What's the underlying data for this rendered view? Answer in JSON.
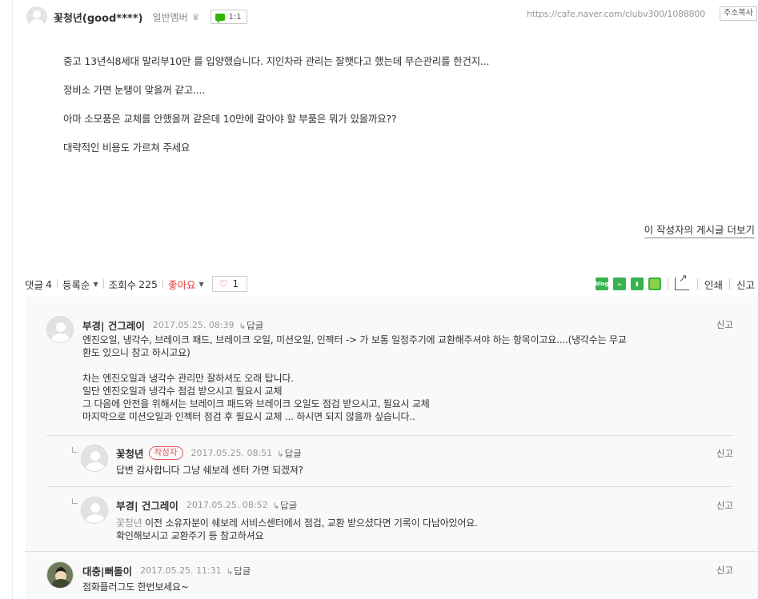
{
  "post": {
    "author_name": "꽃청년(good****)",
    "author_grade": "일반멤버",
    "chat_label": "1:1",
    "url": "https://cafe.naver.com/clubv300/1088800",
    "copy_label": "주소복사",
    "paragraphs": [
      "중고 13년식8세대 말리부10만 를 입양했습니다. 지인차라 관리는 잘햇다고 했는데 무슨관리를 한건지...",
      "정비소 가면 눈탱이 맞을꺼 같고....",
      "아마 소모품은 교체를 안했을꺼 같은데 10만에 갈아야 할 부품은 뭐가 있을까요??",
      "대략적인 비용도 가르쳐 주세요"
    ],
    "more_posts_label": "이 작성자의 게시글 더보기"
  },
  "stats": {
    "comments_label": "댓글",
    "comments_count": "4",
    "sort_label": "등록순",
    "views_label": "조회수",
    "views_count": "225",
    "like_label": "좋아요",
    "like_count": "1",
    "print_label": "인쇄",
    "report_label": "신고"
  },
  "share_icons": [
    "blog-icon",
    "cafe-icon",
    "bookmark-icon",
    "memo-icon",
    "share-icon"
  ],
  "share_blog_text": "blog",
  "comments": [
    {
      "name": "부경| 건그레이",
      "date": "2017.05.25. 08:39",
      "reply": "답글",
      "report": "신고",
      "lines": [
        "엔진오일, 냉각수, 브레이크 패드, 브레이크 오일, 미션오일, 인젝터 -> 가 보통 일정주기에 교환해주셔야 하는 항목이고요....(냉각수는 무교",
        "환도 있으니 참고 하시고요)",
        "",
        "차는 엔진오일과 냉각수 관리만 잘하셔도 오래 탑니다.",
        "일단 엔진오일과 냉각수 점검 받으시고 필요시 교체",
        "그 다음에 안전을 위해서는 브레이크 패드와 브레이크 오일도 점검 받으시고, 필요시 교체",
        "마지막으로 미션오일과 인젝터 점검 후 필요시 교체 ... 하시면 되지 않을까 싶습니다.."
      ]
    },
    {
      "name": "꽃청년",
      "badge": "작성자",
      "date": "2017.05.25. 08:51",
      "reply": "답글",
      "report": "신고",
      "lines": [
        "답변 감사합니다 그냥 쉐보레 센터 가면 되겠져?"
      ]
    },
    {
      "name": "부경| 건그레이",
      "date": "2017.05.25. 08:52",
      "reply": "답글",
      "report": "신고",
      "mention": "꽃청년",
      "lines": [
        " 이전 소유자분이 쉐보레 서비스센터에서 점검, 교환 받으셨다면 기록이 다남아있어요.",
        "확인해보시고 교환주기 등 참고하셔요"
      ]
    },
    {
      "name": "대충|뻐돌이",
      "date": "2017.05.25. 11:31",
      "reply": "답글",
      "report": "신고",
      "lines": [
        "점화플러그도 한번보세요~"
      ]
    }
  ]
}
